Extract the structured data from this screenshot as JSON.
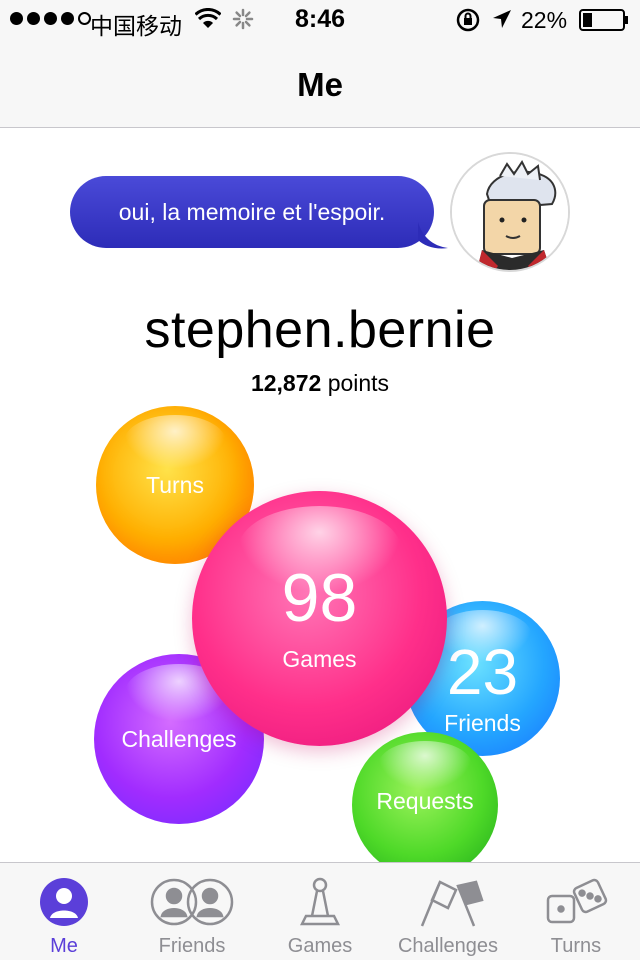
{
  "status_bar": {
    "carrier": "中国移动",
    "time": "8:46",
    "battery_percent": "22%",
    "signal_bars": 4
  },
  "nav": {
    "title": "Me"
  },
  "profile": {
    "status_message": "oui, la memoire et l'espoir.",
    "username": "stephen.bernie",
    "points_value": "12,872",
    "points_label": "points"
  },
  "bubbles": {
    "turns": {
      "label": "Turns",
      "color": "#ffb000"
    },
    "games": {
      "count": "98",
      "label": "Games",
      "color": "#ff2f8a"
    },
    "friends": {
      "count": "23",
      "label": "Friends",
      "color": "#24a6ff"
    },
    "challenges": {
      "label": "Challenges",
      "color": "#a12cff"
    },
    "requests": {
      "label": "Requests",
      "color": "#4ed928"
    }
  },
  "tab_bar": {
    "active_color": "#5b3fd9",
    "tabs": [
      {
        "label": "Me",
        "icon": "person-icon",
        "active": true
      },
      {
        "label": "Friends",
        "icon": "friends-icon",
        "active": false
      },
      {
        "label": "Games",
        "icon": "game-piece-icon",
        "active": false
      },
      {
        "label": "Challenges",
        "icon": "flags-icon",
        "active": false
      },
      {
        "label": "Turns",
        "icon": "dice-icon",
        "active": false
      }
    ]
  }
}
